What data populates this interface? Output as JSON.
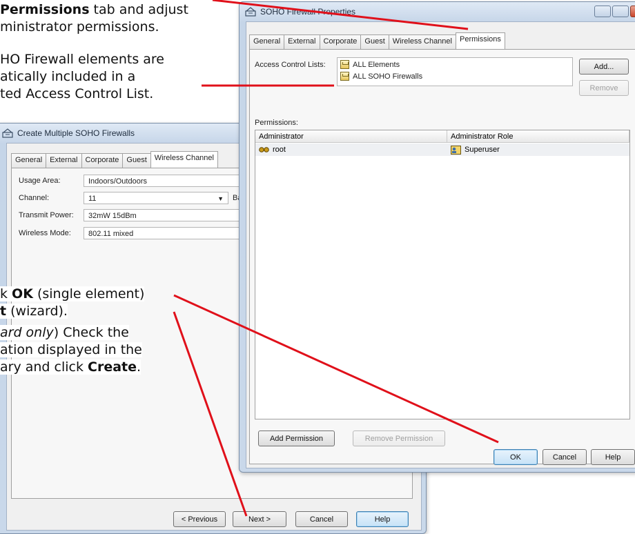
{
  "callouts": {
    "c1_bold": "Permissions",
    "c1_rest": " tab and adjust",
    "c1_line2": "ministrator permissions.",
    "c2_line1": "HO Firewall elements are",
    "c2_line2": "atically included in a",
    "c2_line3": "ted Access Control List.",
    "c3_pre": "k ",
    "c3_ok": "OK",
    "c3_rest": " (single element)",
    "c3_bold2": "t",
    "c3_rest2": " (wizard).",
    "c4_italic": "ard only",
    "c4_rest": ") Check the",
    "c4_line2": "ation displayed in the",
    "c4_pre3": "ary and click ",
    "c4_create": "Create",
    "c4_dot": "."
  },
  "wizard": {
    "title": "Create Multiple SOHO Firewalls",
    "tabs": [
      "General",
      "External",
      "Corporate",
      "Guest",
      "Wireless Channel"
    ],
    "active_tab": "Wireless Channel",
    "usage_area_label": "Usage Area:",
    "usage_area_value": "Indoors/Outdoors",
    "channel_label": "Channel:",
    "channel_value": "11",
    "channel_suffix": "Ba",
    "transmit_power_label": "Transmit Power:",
    "transmit_power_value": "32mW 15dBm",
    "wireless_mode_label": "Wireless Mode:",
    "wireless_mode_value": "802.11 mixed",
    "btn_previous": "< Previous",
    "btn_next": "Next >",
    "btn_cancel": "Cancel",
    "btn_help": "Help"
  },
  "props": {
    "title": "SOHO Firewall Properties",
    "tabs": [
      "General",
      "External",
      "Corporate",
      "Guest",
      "Wireless Channel",
      "Permissions"
    ],
    "active_tab": "Permissions",
    "acl_label": "Access Control Lists:",
    "acl_items": [
      "ALL Elements",
      "ALL SOHO Firewalls"
    ],
    "btn_add": "Add...",
    "btn_remove": "Remove",
    "permissions_label": "Permissions:",
    "col_admin": "Administrator",
    "col_role": "Administrator Role",
    "row_admin": "root",
    "row_role": "Superuser",
    "btn_add_permission": "Add Permission",
    "btn_remove_permission": "Remove Permission",
    "btn_ok": "OK",
    "btn_cancel": "Cancel",
    "btn_help": "Help"
  },
  "colors": {
    "arrow": "#e0101a",
    "title_bar": "#c5d5e8"
  },
  "icons": [
    "firewall-window-icon",
    "acl-element-icon",
    "administrator-icon",
    "role-icon"
  ]
}
